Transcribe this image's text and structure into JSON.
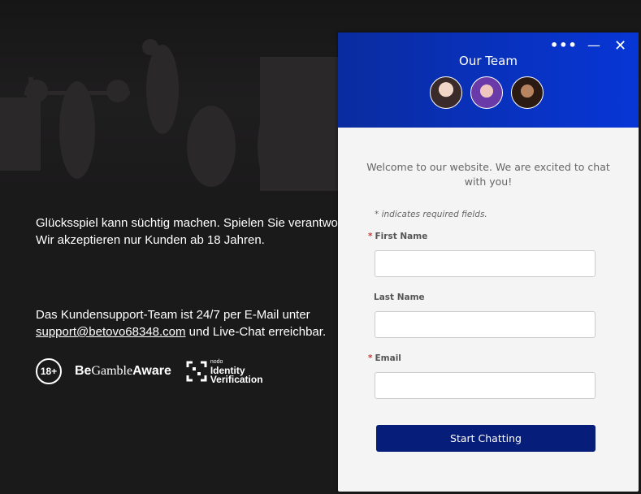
{
  "footer": {
    "notice_line1": "Glücksspiel kann süchtig machen. Spielen Sie verantwortungsbewusst.",
    "notice_line2": "Wir akzeptieren nur Kunden ab 18 Jahren.",
    "support_line1": "Das Kundensupport-Team ist 24/7 per E-Mail unter",
    "support_email": "support@betovo68348.com",
    "support_line2_rest": " und Live-Chat erreichbar.",
    "age_badge": "18+",
    "gamble_be": "Be",
    "gamble_mid": "Gamble",
    "gamble_aware": "Aware",
    "idv_small": "nodo",
    "idv_line1": "Identity",
    "idv_line2": "Verification"
  },
  "chat": {
    "title": "Our Team",
    "menu_icon": "more-dots-icon",
    "welcome": "Welcome to our website. We are excited to chat with you!",
    "required_note": "* indicates required fields.",
    "fields": {
      "first_name_label": "First Name",
      "last_name_label": "Last Name",
      "email_label": "Email"
    },
    "start_button": "Start Chatting",
    "colors": {
      "header_start": "#0a2ca0",
      "header_end": "#0736d6",
      "button": "#071d7a"
    }
  }
}
